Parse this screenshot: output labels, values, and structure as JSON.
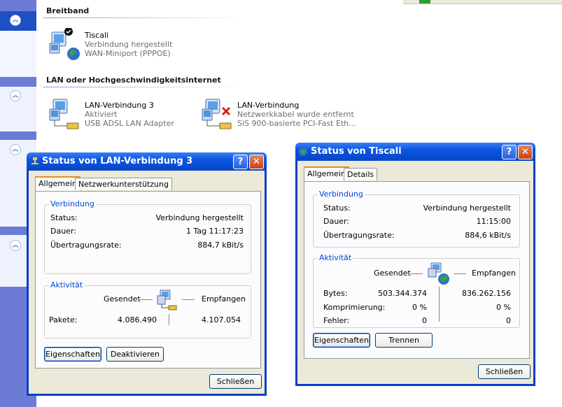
{
  "explorer": {
    "groups": [
      {
        "title": "Breitband"
      },
      {
        "title": "LAN oder Hochgeschwindigkeitsinternet"
      }
    ],
    "connections": [
      {
        "name": "Tiscali",
        "status": "Verbindung hergestellt",
        "device": "WAN-Miniport (PPPOE)"
      },
      {
        "name": "LAN-Verbindung 3",
        "status": "Aktiviert",
        "device": "USB ADSL LAN Adapter"
      },
      {
        "name": "LAN-Verbindung",
        "status": "Netzwerkkabel wurde entfernt",
        "device": "SiS 900-basierte PCI-Fast Eth..."
      }
    ]
  },
  "dialog_lan": {
    "title": "Status von LAN-Verbindung 3",
    "tabs": [
      "Allgemein",
      "Netzwerkunterstützung"
    ],
    "connection_group": "Verbindung",
    "status_label": "Status:",
    "status_value": "Verbindung hergestellt",
    "duration_label": "Dauer:",
    "duration_value": "1 Tag 11:17:23",
    "speed_label": "Übertragungsrate:",
    "speed_value": "884,7 kBit/s",
    "activity_group": "Aktivität",
    "sent_label": "Gesendet",
    "received_label": "Empfangen",
    "packets_label": "Pakete:",
    "packets_sent": "4.086.490",
    "packets_received": "4.107.054",
    "btn_properties": "Eigenschaften",
    "btn_disable": "Deaktivieren",
    "btn_close": "Schließen"
  },
  "dialog_tiscali": {
    "title": "Status von Tiscali",
    "tabs": [
      "Allgemein",
      "Details"
    ],
    "connection_group": "Verbindung",
    "status_label": "Status:",
    "status_value": "Verbindung hergestellt",
    "duration_label": "Dauer:",
    "duration_value": "11:15:00",
    "speed_label": "Übertragungsrate:",
    "speed_value": "884,6 kBit/s",
    "activity_group": "Aktivität",
    "sent_label": "Gesendet",
    "received_label": "Empfangen",
    "bytes_label": "Bytes:",
    "bytes_sent": "503.344.374",
    "bytes_received": "836.262.156",
    "compression_label": "Komprimierung:",
    "compression_sent": "0 %",
    "compression_received": "0 %",
    "errors_label": "Fehler:",
    "errors_sent": "0",
    "errors_received": "0",
    "btn_properties": "Eigenschaften",
    "btn_disconnect": "Trennen",
    "btn_close": "Schließen"
  },
  "titlebar_buttons": {
    "help": "?",
    "close": "✕"
  },
  "colors": {
    "title_blue": "#0a55e0",
    "legend_blue": "#0046d5",
    "tab_highlight": "#e68b2c"
  }
}
